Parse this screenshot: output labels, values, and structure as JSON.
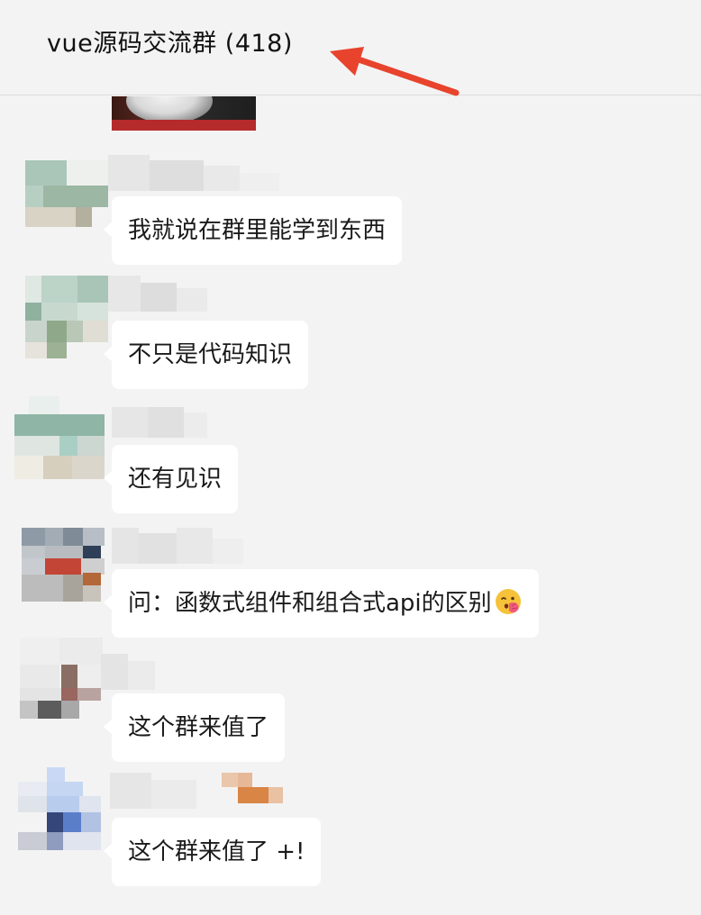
{
  "chat": {
    "title": "vue源码交流群 (418)"
  },
  "messages": [
    {
      "text": "我就说在群里能学到东西"
    },
    {
      "text": "不只是代码知识"
    },
    {
      "text": "还有见识"
    },
    {
      "text": "问：函数式组件和组合式api的区别",
      "emoji": "kissing-face-emoji"
    },
    {
      "text": "这个群来值了"
    },
    {
      "text": "这个群来值了 +!"
    }
  ],
  "colors": {
    "background": "#f3f3f3",
    "bubble": "#ffffff",
    "arrow": "#e8432d"
  }
}
